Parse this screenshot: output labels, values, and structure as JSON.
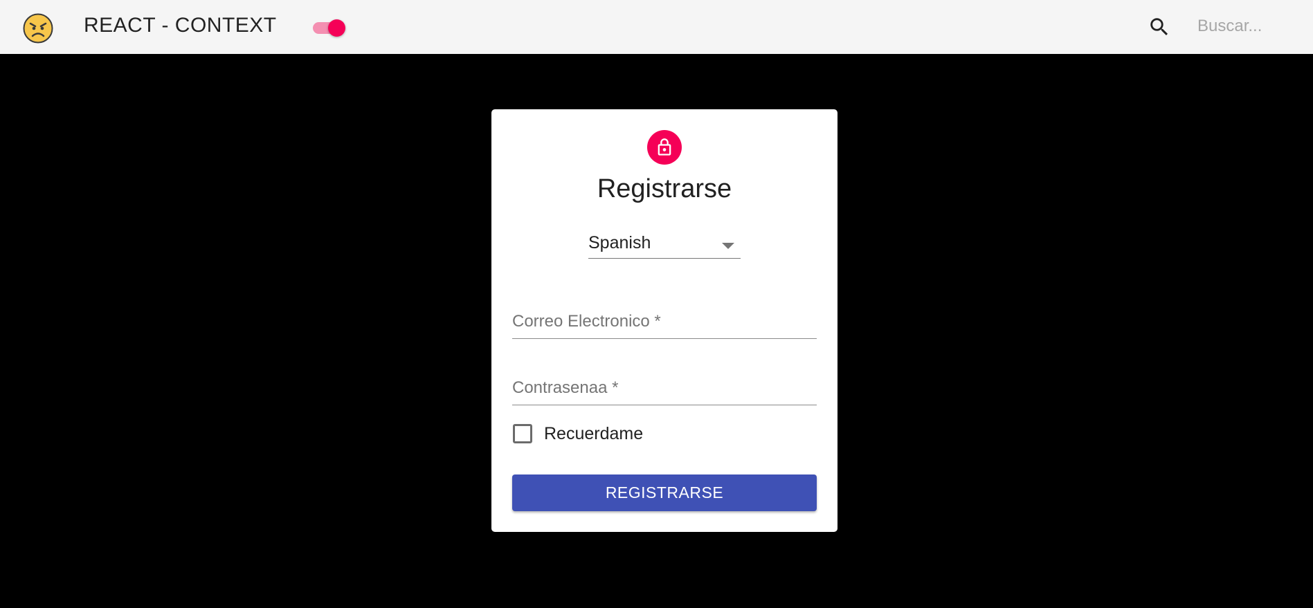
{
  "appbar": {
    "logo_icon": "angry-face-emoji-icon",
    "title": "REACT - CONTEXT",
    "theme_toggle_on": true,
    "search_icon": "search-icon",
    "search_placeholder": "Buscar...",
    "background_color": "#f5f5f5"
  },
  "page": {
    "background_color": "#000000"
  },
  "card": {
    "avatar_icon": "lock-icon",
    "avatar_color": "#f50057",
    "title": "Registrarse",
    "language_select": {
      "value": "Spanish"
    },
    "email_field": {
      "label": "Correo Electronico *",
      "value": ""
    },
    "password_field": {
      "label": "Contrasenaa *",
      "value": ""
    },
    "remember_checkbox": {
      "label": "Recuerdame",
      "checked": false
    },
    "submit_button": {
      "label": "REGISTRARSE",
      "color": "#3f51b5"
    }
  }
}
